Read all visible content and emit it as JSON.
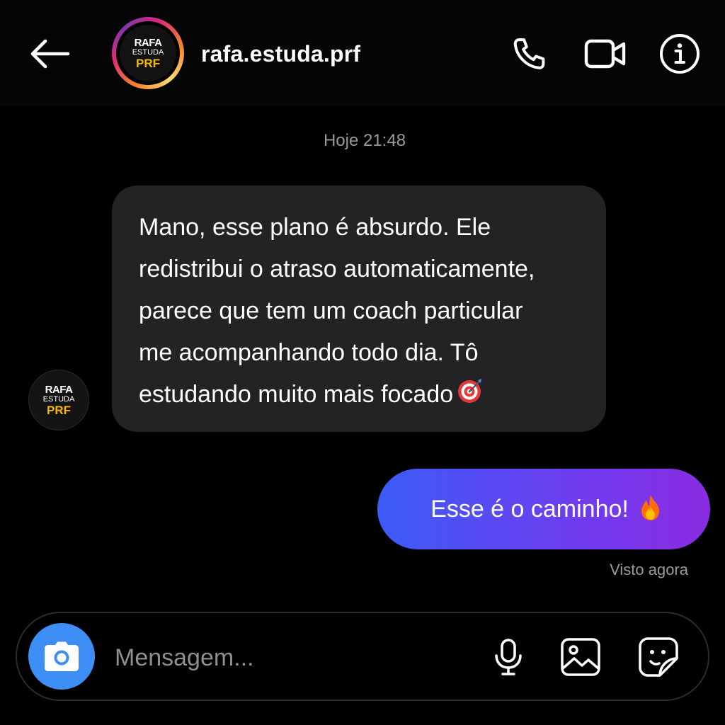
{
  "header": {
    "username": "rafa.estuda.prf",
    "avatar_logo": {
      "line1": "RAFA",
      "line2": "ESTUDA",
      "line3": "PRF"
    }
  },
  "thread": {
    "timestamp": "Hoje 21:48",
    "incoming": {
      "lines": [
        "Mano, esse plano é absurdo. Ele",
        "redistribui o atraso automaticamente,",
        "parece que tem um coach particular",
        "me acompanhando todo dia. Tô",
        "estudando muito mais focado"
      ],
      "emoji": "direct-hit-target-emoji"
    },
    "outgoing": {
      "text": "Esse é o caminho!",
      "emoji": "fire-emoji"
    },
    "seen_status": "Visto agora"
  },
  "composer": {
    "placeholder": "Mensagem..."
  },
  "icons": {
    "back": "back-arrow-icon",
    "call": "phone-icon",
    "video": "video-camera-icon",
    "info": "info-icon",
    "camera": "camera-icon",
    "mic": "microphone-icon",
    "gallery": "image-gallery-icon",
    "sticker": "sticker-icon"
  },
  "colors": {
    "accent_blue": "#3d8ff5",
    "bubble_in": "#232325",
    "bubble_out_start": "#3b5cf6",
    "bubble_out_end": "#8a2be2",
    "logo_yellow": "#f5b800"
  }
}
